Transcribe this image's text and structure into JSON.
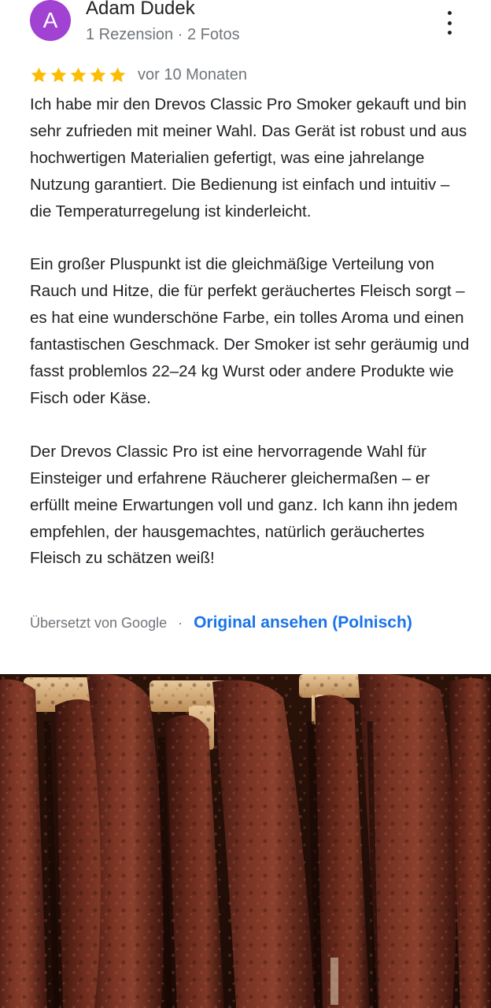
{
  "reviewer": {
    "avatar_letter": "A",
    "name": "Adam Dudek",
    "meta": "1 Rezension · 2 Fotos"
  },
  "menu": {
    "icon": "more-vert-icon"
  },
  "rating": {
    "stars": 5,
    "max": 5,
    "star_color": "#fbbc04",
    "time": "vor 10 Monaten"
  },
  "review": {
    "text": "Ich habe mir den Drevos Classic Pro Smoker gekauft und bin sehr zufrieden mit meiner Wahl. Das Gerät ist robust und aus hochwertigen Materialien gefertigt, was eine jahrelange Nutzung garantiert. Die Bedienung ist einfach und intuitiv – die Temperaturregelung ist kinderleicht.\n\nEin großer Pluspunkt ist die gleichmäßige Verteilung von Rauch und Hitze, die für perfekt geräuchertes Fleisch sorgt – es hat eine wunderschöne Farbe, ein tolles Aroma und einen fantastischen Geschmack. Der Smoker ist sehr geräumig und fasst problemlos 22–24 kg Wurst oder andere Produkte wie Fisch oder Käse.\n\nDer Drevos Classic Pro ist eine hervorragende Wahl für Einsteiger und erfahrene Räucherer gleichermaßen – er erfüllt meine Erwartungen voll und ganz. Ich kann ihn jedem empfehlen, der hausgemachtes, natürlich geräuchertes Fleisch zu schätzen weiß!"
  },
  "translation": {
    "note": "Übersetzt von Google",
    "separator": "·",
    "link": "Original ansehen (Polnisch)",
    "link_color": "#1a73e8"
  },
  "photo": {
    "icon": "smoked-sausages-photo"
  },
  "colors": {
    "avatar": "#a142d2",
    "secondary_text": "#70757a"
  }
}
